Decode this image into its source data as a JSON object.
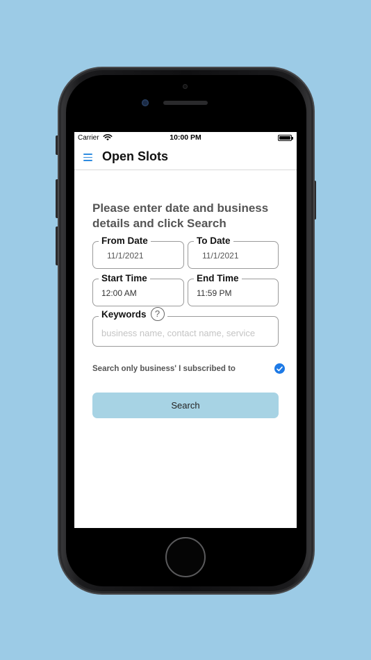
{
  "status_bar": {
    "carrier": "Carrier",
    "time": "10:00 PM",
    "wifi_icon": "wifi-icon",
    "battery_icon": "battery-icon"
  },
  "nav": {
    "title": "Open Slots",
    "menu_icon": "hamburger-menu-icon"
  },
  "form": {
    "prompt": "Please enter date and business details and click Search",
    "from_date": {
      "label": "From Date",
      "value": "11/1/2021"
    },
    "to_date": {
      "label": "To Date",
      "value": "11/1/2021"
    },
    "start_time": {
      "label": "Start Time",
      "value": "12:00 AM"
    },
    "end_time": {
      "label": "End Time",
      "value": "11:59 PM"
    },
    "keywords": {
      "label": "Keywords",
      "help_glyph": "?",
      "placeholder": "business name, contact name, service",
      "value": ""
    },
    "subscribed_only": {
      "label": "Search only business' I subscribed to",
      "checked": true
    },
    "search_label": "Search"
  },
  "colors": {
    "background": "#9ccbe6",
    "accent": "#1e7ae6",
    "button": "#a7d3e4"
  }
}
